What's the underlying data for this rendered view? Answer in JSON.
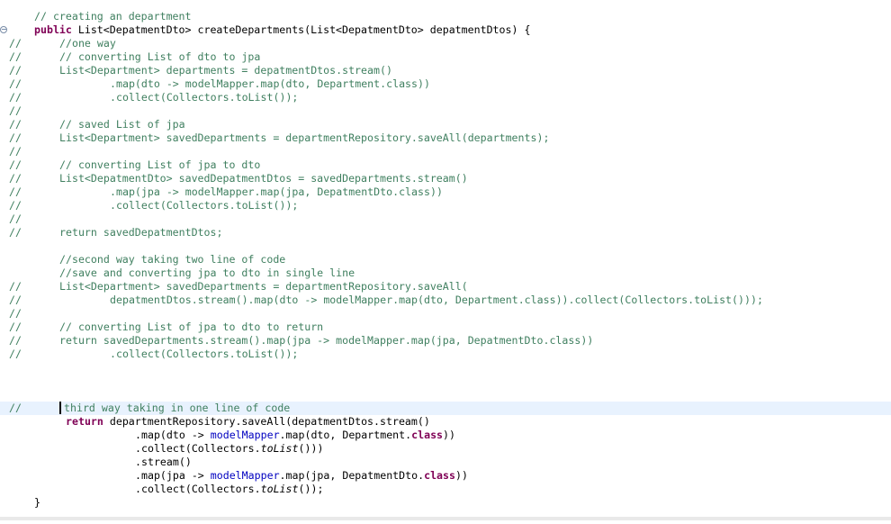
{
  "editor": {
    "comment_prefix": "//",
    "fold_marker": "⊖",
    "lines": [
      {
        "ind": 38,
        "prefix": false,
        "parts": [
          {
            "t": "// creating an department",
            "s": "cmt"
          }
        ]
      },
      {
        "ind": 38,
        "prefix": false,
        "fold": true,
        "parts": [
          {
            "t": "public",
            "s": "kw"
          },
          {
            "t": " List<DepatmentDto> createDepartments(List<DepatmentDto> depatmentDtos) {",
            "s": "txt"
          }
        ]
      },
      {
        "ind": 66,
        "prefix": true,
        "parts": [
          {
            "t": "//one way",
            "s": "cmt"
          }
        ]
      },
      {
        "ind": 66,
        "prefix": true,
        "parts": [
          {
            "t": "// converting List of dto to jpa",
            "s": "cmt"
          }
        ]
      },
      {
        "ind": 66,
        "prefix": true,
        "parts": [
          {
            "t": "List<Department> departments = depatmentDtos.stream()",
            "s": "cmt"
          }
        ]
      },
      {
        "ind": 122,
        "prefix": true,
        "parts": [
          {
            "t": ".map(dto -> modelMapper.map(dto, Department.class))",
            "s": "cmt"
          }
        ]
      },
      {
        "ind": 122,
        "prefix": true,
        "parts": [
          {
            "t": ".collect(Collectors.toList());",
            "s": "cmt"
          }
        ]
      },
      {
        "ind": 66,
        "prefix": true,
        "parts": []
      },
      {
        "ind": 66,
        "prefix": true,
        "parts": [
          {
            "t": "// saved List of jpa",
            "s": "cmt"
          }
        ]
      },
      {
        "ind": 66,
        "prefix": true,
        "parts": [
          {
            "t": "List<Department> savedDepartments = departmentRepository.saveAll(departments);",
            "s": "cmt"
          }
        ]
      },
      {
        "ind": 66,
        "prefix": true,
        "parts": []
      },
      {
        "ind": 66,
        "prefix": true,
        "parts": [
          {
            "t": "// converting List of jpa to dto",
            "s": "cmt"
          }
        ]
      },
      {
        "ind": 66,
        "prefix": true,
        "parts": [
          {
            "t": "List<DepatmentDto> savedDepatmentDtos = savedDepartments.stream()",
            "s": "cmt"
          }
        ]
      },
      {
        "ind": 122,
        "prefix": true,
        "parts": [
          {
            "t": ".map(jpa -> modelMapper.map(jpa, DepatmentDto.class))",
            "s": "cmt"
          }
        ]
      },
      {
        "ind": 122,
        "prefix": true,
        "parts": [
          {
            "t": ".collect(Collectors.toList());",
            "s": "cmt"
          }
        ]
      },
      {
        "ind": 66,
        "prefix": true,
        "parts": []
      },
      {
        "ind": 66,
        "prefix": true,
        "parts": [
          {
            "t": "return savedDepatmentDtos;",
            "s": "cmt"
          }
        ]
      },
      {
        "ind": 66,
        "prefix": false,
        "parts": []
      },
      {
        "ind": 66,
        "prefix": false,
        "parts": [
          {
            "t": "//second way taking two line of code",
            "s": "cmt"
          }
        ]
      },
      {
        "ind": 66,
        "prefix": false,
        "parts": [
          {
            "t": "//save and converting jpa to dto in single line",
            "s": "cmt"
          }
        ]
      },
      {
        "ind": 66,
        "prefix": true,
        "parts": [
          {
            "t": "List<Department> savedDepartments = departmentRepository.saveAll(",
            "s": "cmt"
          }
        ]
      },
      {
        "ind": 122,
        "prefix": true,
        "parts": [
          {
            "t": "depatmentDtos.stream().map(dto -> modelMapper.map(dto, Department.class)).collect(Collectors.toList()));",
            "s": "cmt"
          }
        ]
      },
      {
        "ind": 66,
        "prefix": true,
        "parts": []
      },
      {
        "ind": 66,
        "prefix": true,
        "parts": [
          {
            "t": "// converting List of jpa to dto to return",
            "s": "cmt"
          }
        ]
      },
      {
        "ind": 66,
        "prefix": true,
        "parts": [
          {
            "t": "return savedDepartments.stream().map(jpa -> modelMapper.map(jpa, DepatmentDto.class))",
            "s": "cmt"
          }
        ]
      },
      {
        "ind": 122,
        "prefix": true,
        "parts": [
          {
            "t": ".collect(Collectors.toList());",
            "s": "cmt"
          }
        ]
      },
      {
        "ind": 66,
        "prefix": false,
        "parts": []
      },
      {
        "ind": 66,
        "prefix": false,
        "parts": []
      },
      {
        "ind": 66,
        "prefix": false,
        "parts": []
      },
      {
        "ind": 66,
        "prefix": true,
        "current": true,
        "caret": true,
        "parts": [
          {
            "t": "third way taking in one line of code",
            "s": "cmt"
          }
        ]
      },
      {
        "ind": 73,
        "prefix": false,
        "parts": [
          {
            "t": "return",
            "s": "kw"
          },
          {
            "t": " departmentRepository.saveAll(depatmentDtos.stream()",
            "s": "txt"
          }
        ]
      },
      {
        "ind": 150,
        "prefix": false,
        "parts": [
          {
            "t": ".map(dto -> ",
            "s": "txt"
          },
          {
            "t": "modelMapper",
            "s": "fld"
          },
          {
            "t": ".map(dto, Department.",
            "s": "txt"
          },
          {
            "t": "class",
            "s": "kw"
          },
          {
            "t": "))",
            "s": "txt"
          }
        ]
      },
      {
        "ind": 150,
        "prefix": false,
        "parts": [
          {
            "t": ".collect(Collectors.",
            "s": "txt"
          },
          {
            "t": "toList",
            "s": "ital"
          },
          {
            "t": "()))",
            "s": "txt"
          }
        ]
      },
      {
        "ind": 150,
        "prefix": false,
        "parts": [
          {
            "t": ".stream()",
            "s": "txt"
          }
        ]
      },
      {
        "ind": 150,
        "prefix": false,
        "parts": [
          {
            "t": ".map(jpa -> ",
            "s": "txt"
          },
          {
            "t": "modelMapper",
            "s": "fld"
          },
          {
            "t": ".map(jpa, DepatmentDto.",
            "s": "txt"
          },
          {
            "t": "class",
            "s": "kw"
          },
          {
            "t": "))",
            "s": "txt"
          }
        ]
      },
      {
        "ind": 150,
        "prefix": false,
        "parts": [
          {
            "t": ".collect(Collectors.",
            "s": "txt"
          },
          {
            "t": "toList",
            "s": "ital"
          },
          {
            "t": "());",
            "s": "txt"
          }
        ]
      },
      {
        "ind": 38,
        "prefix": false,
        "parts": [
          {
            "t": "}",
            "s": "txt"
          }
        ]
      }
    ]
  }
}
